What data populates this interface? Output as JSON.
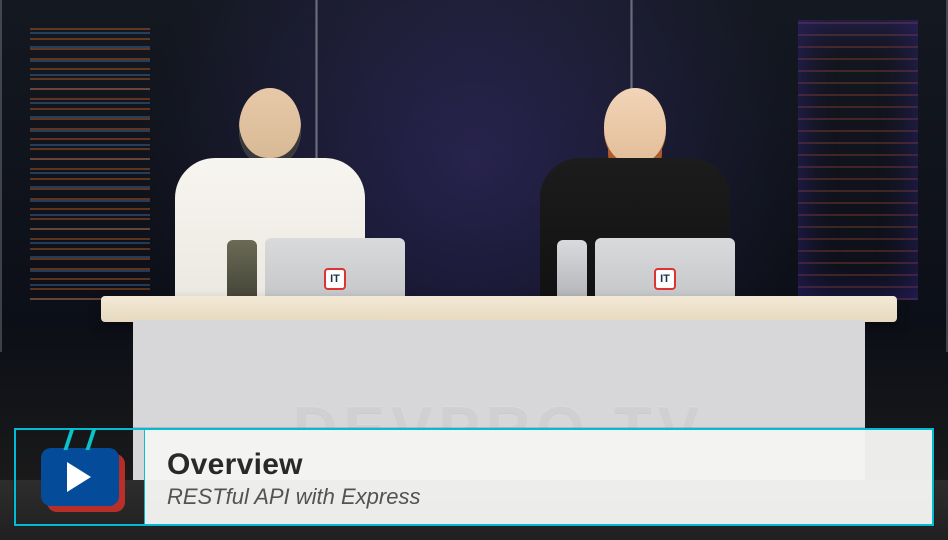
{
  "lower_third": {
    "title": "Overview",
    "subtitle": "RESTful API with Express"
  },
  "desk": {
    "watermark": "DEVPRO.TV"
  },
  "laptop_badge": "IT"
}
